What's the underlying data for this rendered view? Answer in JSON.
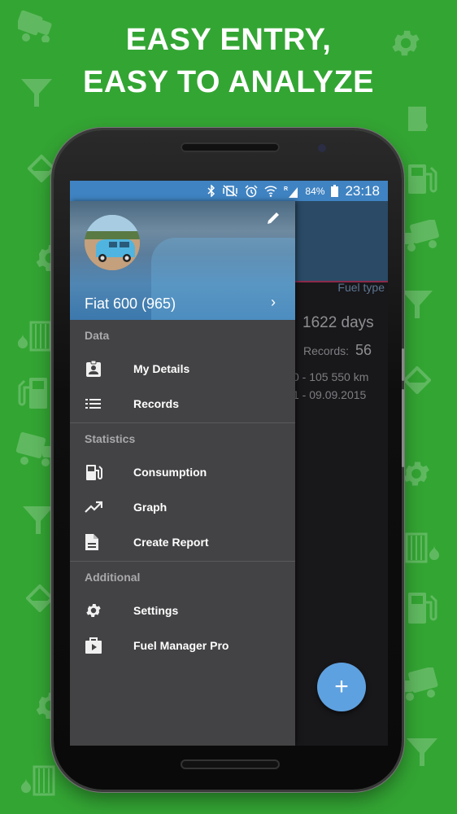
{
  "headline": {
    "line1": "EASY ENTRY,",
    "line2": "EASY TO ANALYZE"
  },
  "colors": {
    "background": "#33a533",
    "statusbar": "#3f83c2",
    "drawer": "#434244",
    "fab": "#5ea1e0",
    "accent_line": "#8a2a4a"
  },
  "statusbar": {
    "icons": [
      "bluetooth-icon",
      "vibrate-off-icon",
      "alarm-icon",
      "wifi-icon",
      "signal-roaming-icon",
      "battery-icon"
    ],
    "roaming": "R",
    "battery_percent": "84%",
    "time": "23:18"
  },
  "background_screen": {
    "header_label": "Fuel type",
    "days": "1622 days",
    "records_label": "Records:",
    "records_value": "56",
    "km_range": "0 - 105 550 km",
    "date_range": "1 - 09.09.2015"
  },
  "drawer": {
    "vehicle_name": "Fiat 600 (965)",
    "edit_icon": "pencil-icon",
    "chevron": "›",
    "sections": [
      {
        "label": "Data",
        "items": [
          {
            "label": "My Details",
            "icon": "badge-icon"
          },
          {
            "label": "Records",
            "icon": "list-icon"
          }
        ]
      },
      {
        "label": "Statistics",
        "items": [
          {
            "label": "Consumption",
            "icon": "fuel-pump-icon"
          },
          {
            "label": "Graph",
            "icon": "trending-up-icon"
          },
          {
            "label": "Create Report",
            "icon": "document-icon"
          }
        ]
      },
      {
        "label": "Additional",
        "items": [
          {
            "label": "Settings",
            "icon": "gear-icon"
          },
          {
            "label": "Fuel Manager Pro",
            "icon": "play-store-icon"
          }
        ]
      }
    ]
  },
  "fab": {
    "label": "+",
    "icon": "add-icon"
  }
}
